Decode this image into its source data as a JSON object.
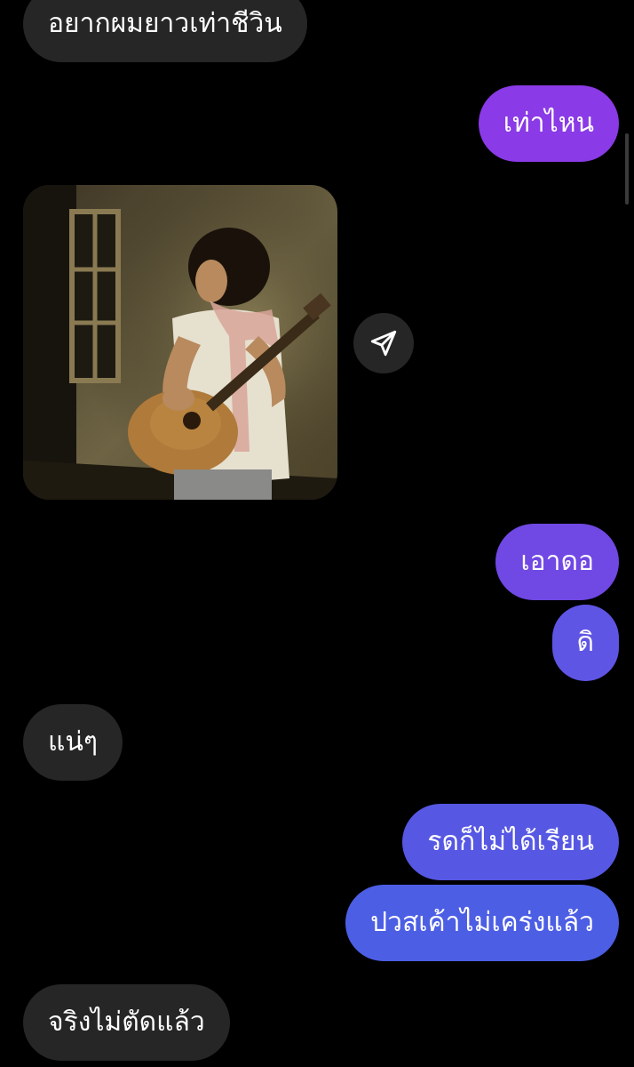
{
  "messages": [
    {
      "text": "อยากผมยาวเท่าชีวิน"
    },
    {
      "text": "เท่าไหน"
    },
    {
      "text": "เอาดอ"
    },
    {
      "text": "ดิ"
    },
    {
      "text": "แน่ๆ"
    },
    {
      "text": "รดก็ไม่ได้เรียน"
    },
    {
      "text": "ปวสเค้าไม่เคร่งแล้ว"
    },
    {
      "text": "จริงไม่ตัดแล้ว"
    }
  ],
  "shared_photo": {
    "description_icon": "share-icon"
  },
  "colors": {
    "background": "#000000",
    "incoming_bubble": "#262626",
    "outgoing_gradient_top": "#8a3ae6",
    "outgoing_gradient_bottom": "#4c5ee4"
  }
}
